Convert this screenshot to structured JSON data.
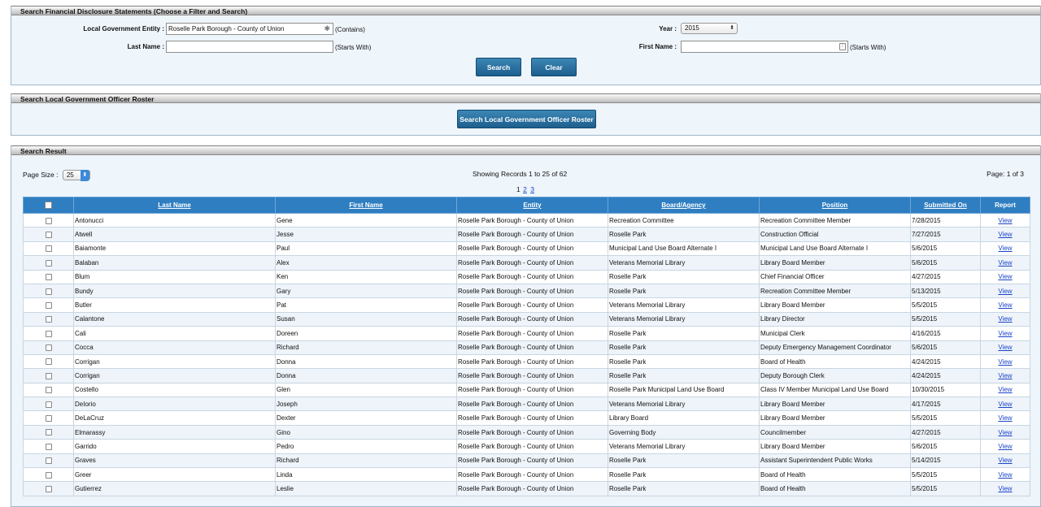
{
  "search_panel": {
    "title": "Search Financial Disclosure Statements (Choose a Filter and Search)",
    "entity_label": "Local Government Entity :",
    "entity_value": "Roselle Park Borough - County of Union",
    "entity_hint": "(Contains)",
    "year_label": "Year :",
    "year_value": "2015",
    "last_name_label": "Last Name :",
    "last_name_value": "",
    "last_name_hint": "(Starts With)",
    "first_name_label": "First Name :",
    "first_name_value": "",
    "first_name_hint": "(Starts With)",
    "search_button": "Search",
    "clear_button": "Clear"
  },
  "roster_panel": {
    "title": "Search Local Government Officer Roster",
    "button": "Search Local Government Officer Roster"
  },
  "result_panel": {
    "title": "Search Result",
    "page_size_label": "Page Size :",
    "page_size_value": "25",
    "showing": "Showing Records 1 to 25 of 62",
    "page_info": "Page: 1 of 3",
    "pages": [
      "1",
      "2",
      "3"
    ],
    "columns": [
      "Last Name",
      "First Name",
      "Entity",
      "Board/Agency",
      "Position",
      "Submitted On",
      "Report"
    ],
    "rows": [
      {
        "last": "Antonucci",
        "first": "Gene",
        "entity": "Roselle Park Borough - County of Union",
        "board": "Recreation Committee",
        "position": "Recreation Committee Member",
        "submitted": "7/28/2015",
        "report": "View"
      },
      {
        "last": "Atwell",
        "first": "Jesse",
        "entity": "Roselle Park Borough - County of Union",
        "board": "Roselle Park",
        "position": "Construction Official",
        "submitted": "7/27/2015",
        "report": "View"
      },
      {
        "last": "Baiamonte",
        "first": "Paul",
        "entity": "Roselle Park Borough - County of Union",
        "board": "Municipal Land Use Board Alternate I",
        "position": "Municipal Land Use Board Alternate I",
        "submitted": "5/6/2015",
        "report": "View"
      },
      {
        "last": "Balaban",
        "first": "Alex",
        "entity": "Roselle Park Borough - County of Union",
        "board": "Veterans Memorial Library",
        "position": "Library Board Member",
        "submitted": "5/6/2015",
        "report": "View"
      },
      {
        "last": "Blum",
        "first": "Ken",
        "entity": "Roselle Park Borough - County of Union",
        "board": "Roselle Park",
        "position": "Chief Financial Officer",
        "submitted": "4/27/2015",
        "report": "View"
      },
      {
        "last": "Bundy",
        "first": "Gary",
        "entity": "Roselle Park Borough - County of Union",
        "board": "Roselle Park",
        "position": "Recreation Committee Member",
        "submitted": "5/13/2015",
        "report": "View"
      },
      {
        "last": "Butler",
        "first": "Pat",
        "entity": "Roselle Park Borough - County of Union",
        "board": "Veterans Memorial Library",
        "position": "Library Board Member",
        "submitted": "5/5/2015",
        "report": "View"
      },
      {
        "last": "Calantone",
        "first": "Susan",
        "entity": "Roselle Park Borough - County of Union",
        "board": "Veterans Memorial Library",
        "position": "Library Director",
        "submitted": "5/5/2015",
        "report": "View"
      },
      {
        "last": "Cali",
        "first": "Doreen",
        "entity": "Roselle Park Borough - County of Union",
        "board": "Roselle Park",
        "position": "Municipal Clerk",
        "submitted": "4/16/2015",
        "report": "View"
      },
      {
        "last": "Cocca",
        "first": "Richard",
        "entity": "Roselle Park Borough - County of Union",
        "board": "Roselle Park",
        "position": "Deputy Emergency Management Coordinator",
        "submitted": "5/6/2015",
        "report": "View"
      },
      {
        "last": "Corrigan",
        "first": "Donna",
        "entity": "Roselle Park Borough - County of Union",
        "board": "Roselle Park",
        "position": "Board of Health",
        "submitted": "4/24/2015",
        "report": "View"
      },
      {
        "last": "Corrigan",
        "first": "Donna",
        "entity": "Roselle Park Borough - County of Union",
        "board": "Roselle Park",
        "position": "Deputy Borough Clerk",
        "submitted": "4/24/2015",
        "report": "View"
      },
      {
        "last": "Costello",
        "first": "Glen",
        "entity": "Roselle Park Borough - County of Union",
        "board": "Roselle Park Municipal Land Use Board",
        "position": "Class IV Member Municipal Land Use Board",
        "submitted": "10/30/2015",
        "report": "View"
      },
      {
        "last": "DeIorio",
        "first": "Joseph",
        "entity": "Roselle Park Borough - County of Union",
        "board": "Veterans Memorial Library",
        "position": "Library Board Member",
        "submitted": "4/17/2015",
        "report": "View"
      },
      {
        "last": "DeLaCruz",
        "first": "Dexter",
        "entity": "Roselle Park Borough - County of Union",
        "board": "Library Board",
        "position": "Library Board Member",
        "submitted": "5/5/2015",
        "report": "View"
      },
      {
        "last": "Elmarassy",
        "first": "Gino",
        "entity": "Roselle Park Borough - County of Union",
        "board": "Governing Body",
        "position": "Councilmember",
        "submitted": "4/27/2015",
        "report": "View"
      },
      {
        "last": "Garrido",
        "first": "Pedro",
        "entity": "Roselle Park Borough - County of Union",
        "board": "Veterans Memorial Library",
        "position": "Library Board Member",
        "submitted": "5/6/2015",
        "report": "View"
      },
      {
        "last": "Graves",
        "first": "Richard",
        "entity": "Roselle Park Borough - County of Union",
        "board": "Roselle Park",
        "position": "Assistant Superintendent Public Works",
        "submitted": "5/14/2015",
        "report": "View"
      },
      {
        "last": "Greer",
        "first": "Linda",
        "entity": "Roselle Park Borough - County of Union",
        "board": "Roselle Park",
        "position": "Board of Health",
        "submitted": "5/5/2015",
        "report": "View"
      },
      {
        "last": "Gutierrez",
        "first": "Leslie",
        "entity": "Roselle Park Borough - County of Union",
        "board": "Roselle Park",
        "position": "Board of Health",
        "submitted": "5/5/2015",
        "report": "View"
      }
    ]
  }
}
